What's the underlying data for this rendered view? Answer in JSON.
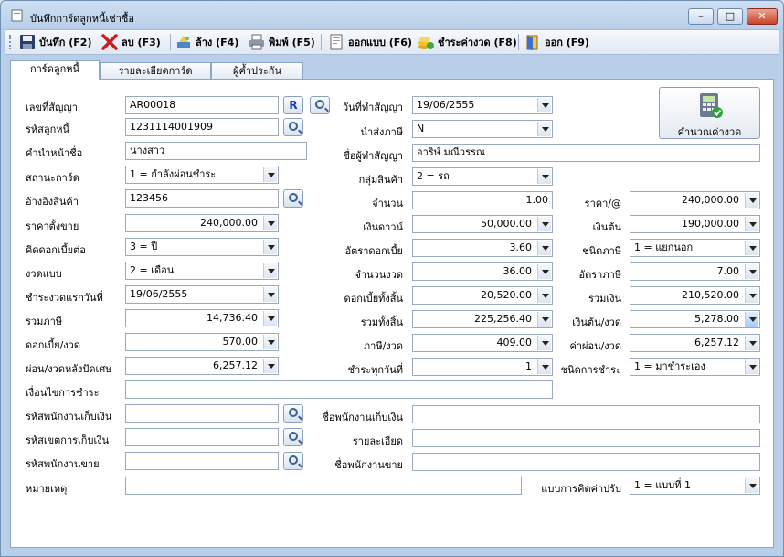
{
  "window": {
    "title": "บันทึกการ์ดลูกหนี้เช่าซื้อ"
  },
  "toolbar": {
    "save": "บันทึก (F2)",
    "delete": "ลบ (F3)",
    "clear": "ล้าง (F4)",
    "print": "พิมพ์ (F5)",
    "design": "ออกแบบ (F6)",
    "pay_installment": "ชำระค่างวด (F8)",
    "exit": "ออก (F9)"
  },
  "tabs": [
    "การ์ดลูกหนี้",
    "รายละเอียดการ์ด",
    "ผู้ค้ำประกัน"
  ],
  "calc_button": "คำนวณค่างวด",
  "form": {
    "contract_no": {
      "label": "เลขที่สัญญา",
      "value": "AR00018"
    },
    "r_button": "R",
    "contract_date": {
      "label": "วันที่ทำสัญญา",
      "value": "19/06/2555"
    },
    "debtor_code": {
      "label": "รหัสลูกหนี้",
      "value": "1231114001909"
    },
    "tax_send": {
      "label": "นำส่งภาษี",
      "value": "N"
    },
    "name_prefix": {
      "label": "คำนำหน้าชื่อ",
      "value": "นางสาว"
    },
    "contract_party": {
      "label": "ชื่อผู้ทำสัญญา",
      "value": "อาริษ์ มณีวรรณ"
    },
    "card_status": {
      "label": "สถานะการ์ด",
      "value": "1 = กำลังผ่อนชำระ"
    },
    "product_group": {
      "label": "กลุ่มสินค้า",
      "value": "2 = รถ"
    },
    "product_ref": {
      "label": "อ้างอิงสินค้า",
      "value": "123456"
    },
    "quantity": {
      "label": "จำนวน",
      "value": "1.00"
    },
    "unit_price": {
      "label": "ราคา/@",
      "value": "240,000.00"
    },
    "sale_price": {
      "label": "ราคาตั้งขาย",
      "value": "240,000.00"
    },
    "down_payment": {
      "label": "เงินดาวน์",
      "value": "50,000.00"
    },
    "principal": {
      "label": "เงินต้น",
      "value": "190,000.00"
    },
    "interest_per": {
      "label": "คิดดอกเบี้ยต่อ",
      "value": "3 = ปี"
    },
    "interest_rate": {
      "label": "อัตราดอกเบี้ย",
      "value": "3.60"
    },
    "tax_type": {
      "label": "ชนิดภาษี",
      "value": "1 = แยกนอก"
    },
    "installment_type": {
      "label": "งวดแบบ",
      "value": "2 = เดือน"
    },
    "installment_count": {
      "label": "จำนวนงวด",
      "value": "36.00"
    },
    "tax_rate": {
      "label": "อัตราภาษี",
      "value": "7.00"
    },
    "first_pay_date": {
      "label": "ชำระงวดแรกวันที่",
      "value": "19/06/2555"
    },
    "total_interest": {
      "label": "ดอกเบี้ยทั้งสิ้น",
      "value": "20,520.00"
    },
    "total_money": {
      "label": "รวมเงิน",
      "value": "210,520.00"
    },
    "total_tax": {
      "label": "รวมภาษี",
      "value": "14,736.40"
    },
    "grand_total": {
      "label": "รวมทั้งสิ้น",
      "value": "225,256.40"
    },
    "principal_per_inst": {
      "label": "เงินต้น/งวด",
      "value": "5,278.00"
    },
    "interest_per_inst": {
      "label": "ดอกเบี้ย/งวด",
      "value": "570.00"
    },
    "tax_per_inst": {
      "label": "ภาษี/งวด",
      "value": "409.00"
    },
    "payment_per_inst": {
      "label": "ค่าผ่อน/งวด",
      "value": "6,257.12"
    },
    "pay_after_round": {
      "label": "ผ่อน/งวดหลังปัดเศษ",
      "value": "6,257.12"
    },
    "pay_every_day": {
      "label": "ชำระทุกวันที่",
      "value": "1"
    },
    "payment_type": {
      "label": "ชนิดการชำระ",
      "value": "1 = มาชำระเอง"
    },
    "payment_conditions": {
      "label": "เงื่อนไขการชำระ",
      "value": ""
    },
    "collector_code": {
      "label": "รหัสพนักงานเก็บเงิน",
      "value": ""
    },
    "collector_name": {
      "label": "ชื่อพนักงานเก็บเงิน",
      "value": ""
    },
    "collect_area_code": {
      "label": "รหัสเขตการเก็บเงิน",
      "value": ""
    },
    "collect_area_detail": {
      "label": "รายละเอียด",
      "value": ""
    },
    "sales_code": {
      "label": "รหัสพนักงานขาย",
      "value": ""
    },
    "sales_name": {
      "label": "ชื่อพนักงานขาย",
      "value": ""
    },
    "note": {
      "label": "หมายเหตุ",
      "value": ""
    },
    "fine_method": {
      "label": "แบบการคิดค่าปรับ",
      "value": "1 = แบบที่ 1"
    }
  },
  "colors": {
    "panel_bg": "#ffffff",
    "window_bg": "#dce7f5",
    "accent": "#1738c8"
  }
}
